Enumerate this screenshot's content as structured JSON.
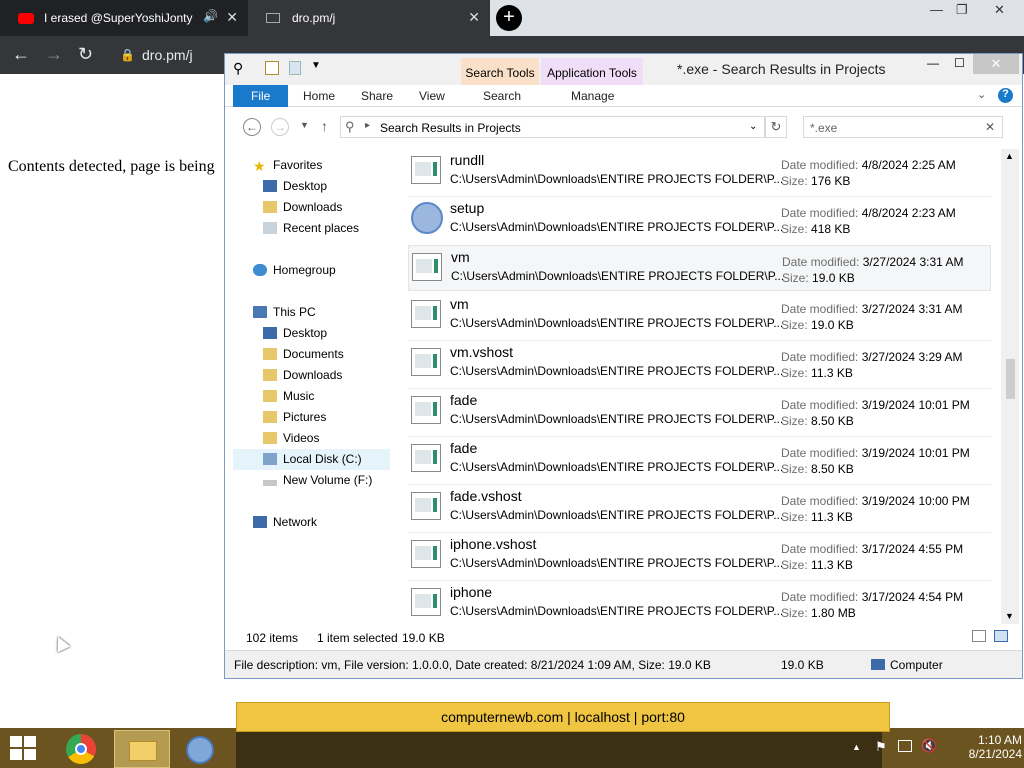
{
  "browser": {
    "tabs": [
      {
        "title": "I erased @SuperYoshiJonty"
      },
      {
        "title": "dro.pm/j"
      }
    ],
    "address": "dro.pm/j"
  },
  "page": {
    "text": "Contents detected, page is being"
  },
  "explorer": {
    "title": "*.exe - Search Results in Projects",
    "context_tabs": [
      "Search Tools",
      "Application Tools"
    ],
    "ribbon_tabs": [
      "File",
      "Home",
      "Share",
      "View",
      "Search",
      "Manage"
    ],
    "address": "Search Results in Projects",
    "search_value": "*.exe",
    "nav": {
      "favorites": "Favorites",
      "favorites_items": [
        "Desktop",
        "Downloads",
        "Recent places"
      ],
      "homegroup": "Homegroup",
      "thispc": "This PC",
      "pc_items": [
        "Desktop",
        "Documents",
        "Downloads",
        "Music",
        "Pictures",
        "Videos",
        "Local Disk (C:)",
        "New Volume (F:)"
      ],
      "network": "Network"
    },
    "labels": {
      "date": "Date modified:",
      "size": "Size:"
    },
    "files": [
      {
        "name": "rundll",
        "path": "C:\\Users\\Admin\\Downloads\\ENTIRE PROJECTS FOLDER\\P...",
        "date": "4/8/2024 2:25 AM",
        "size": "176 KB"
      },
      {
        "name": "setup",
        "path": "C:\\Users\\Admin\\Downloads\\ENTIRE PROJECTS FOLDER\\P...",
        "date": "4/8/2024 2:23 AM",
        "size": "418 KB"
      },
      {
        "name": "vm",
        "path": "C:\\Users\\Admin\\Downloads\\ENTIRE PROJECTS FOLDER\\P...",
        "date": "3/27/2024 3:31 AM",
        "size": "19.0 KB"
      },
      {
        "name": "vm",
        "path": "C:\\Users\\Admin\\Downloads\\ENTIRE PROJECTS FOLDER\\P...",
        "date": "3/27/2024 3:31 AM",
        "size": "19.0 KB"
      },
      {
        "name": "vm.vshost",
        "path": "C:\\Users\\Admin\\Downloads\\ENTIRE PROJECTS FOLDER\\P...",
        "date": "3/27/2024 3:29 AM",
        "size": "11.3 KB"
      },
      {
        "name": "fade",
        "path": "C:\\Users\\Admin\\Downloads\\ENTIRE PROJECTS FOLDER\\P...",
        "date": "3/19/2024 10:01 PM",
        "size": "8.50 KB"
      },
      {
        "name": "fade",
        "path": "C:\\Users\\Admin\\Downloads\\ENTIRE PROJECTS FOLDER\\P...",
        "date": "3/19/2024 10:01 PM",
        "size": "8.50 KB"
      },
      {
        "name": "fade.vshost",
        "path": "C:\\Users\\Admin\\Downloads\\ENTIRE PROJECTS FOLDER\\P...",
        "date": "3/19/2024 10:00 PM",
        "size": "11.3 KB"
      },
      {
        "name": "iphone.vshost",
        "path": "C:\\Users\\Admin\\Downloads\\ENTIRE PROJECTS FOLDER\\P...",
        "date": "3/17/2024 4:55 PM",
        "size": "11.3 KB"
      },
      {
        "name": "iphone",
        "path": "C:\\Users\\Admin\\Downloads\\ENTIRE PROJECTS FOLDER\\P...",
        "date": "3/17/2024 4:54 PM",
        "size": "1.80 MB"
      }
    ],
    "status": {
      "count": "102 items",
      "selected": "1 item selected",
      "selected_size": "19.0 KB"
    },
    "details": {
      "text": "File description: vm, File version: 1.0.0.0, Date created: 8/21/2024 1:09 AM, Size: 19.0 KB",
      "size": "19.0 KB",
      "location": "Computer"
    }
  },
  "notice": {
    "text": "computernewb.com | localhost | port:80"
  },
  "taskbar": {
    "time": "1:10 AM",
    "date": "8/21/2024"
  }
}
